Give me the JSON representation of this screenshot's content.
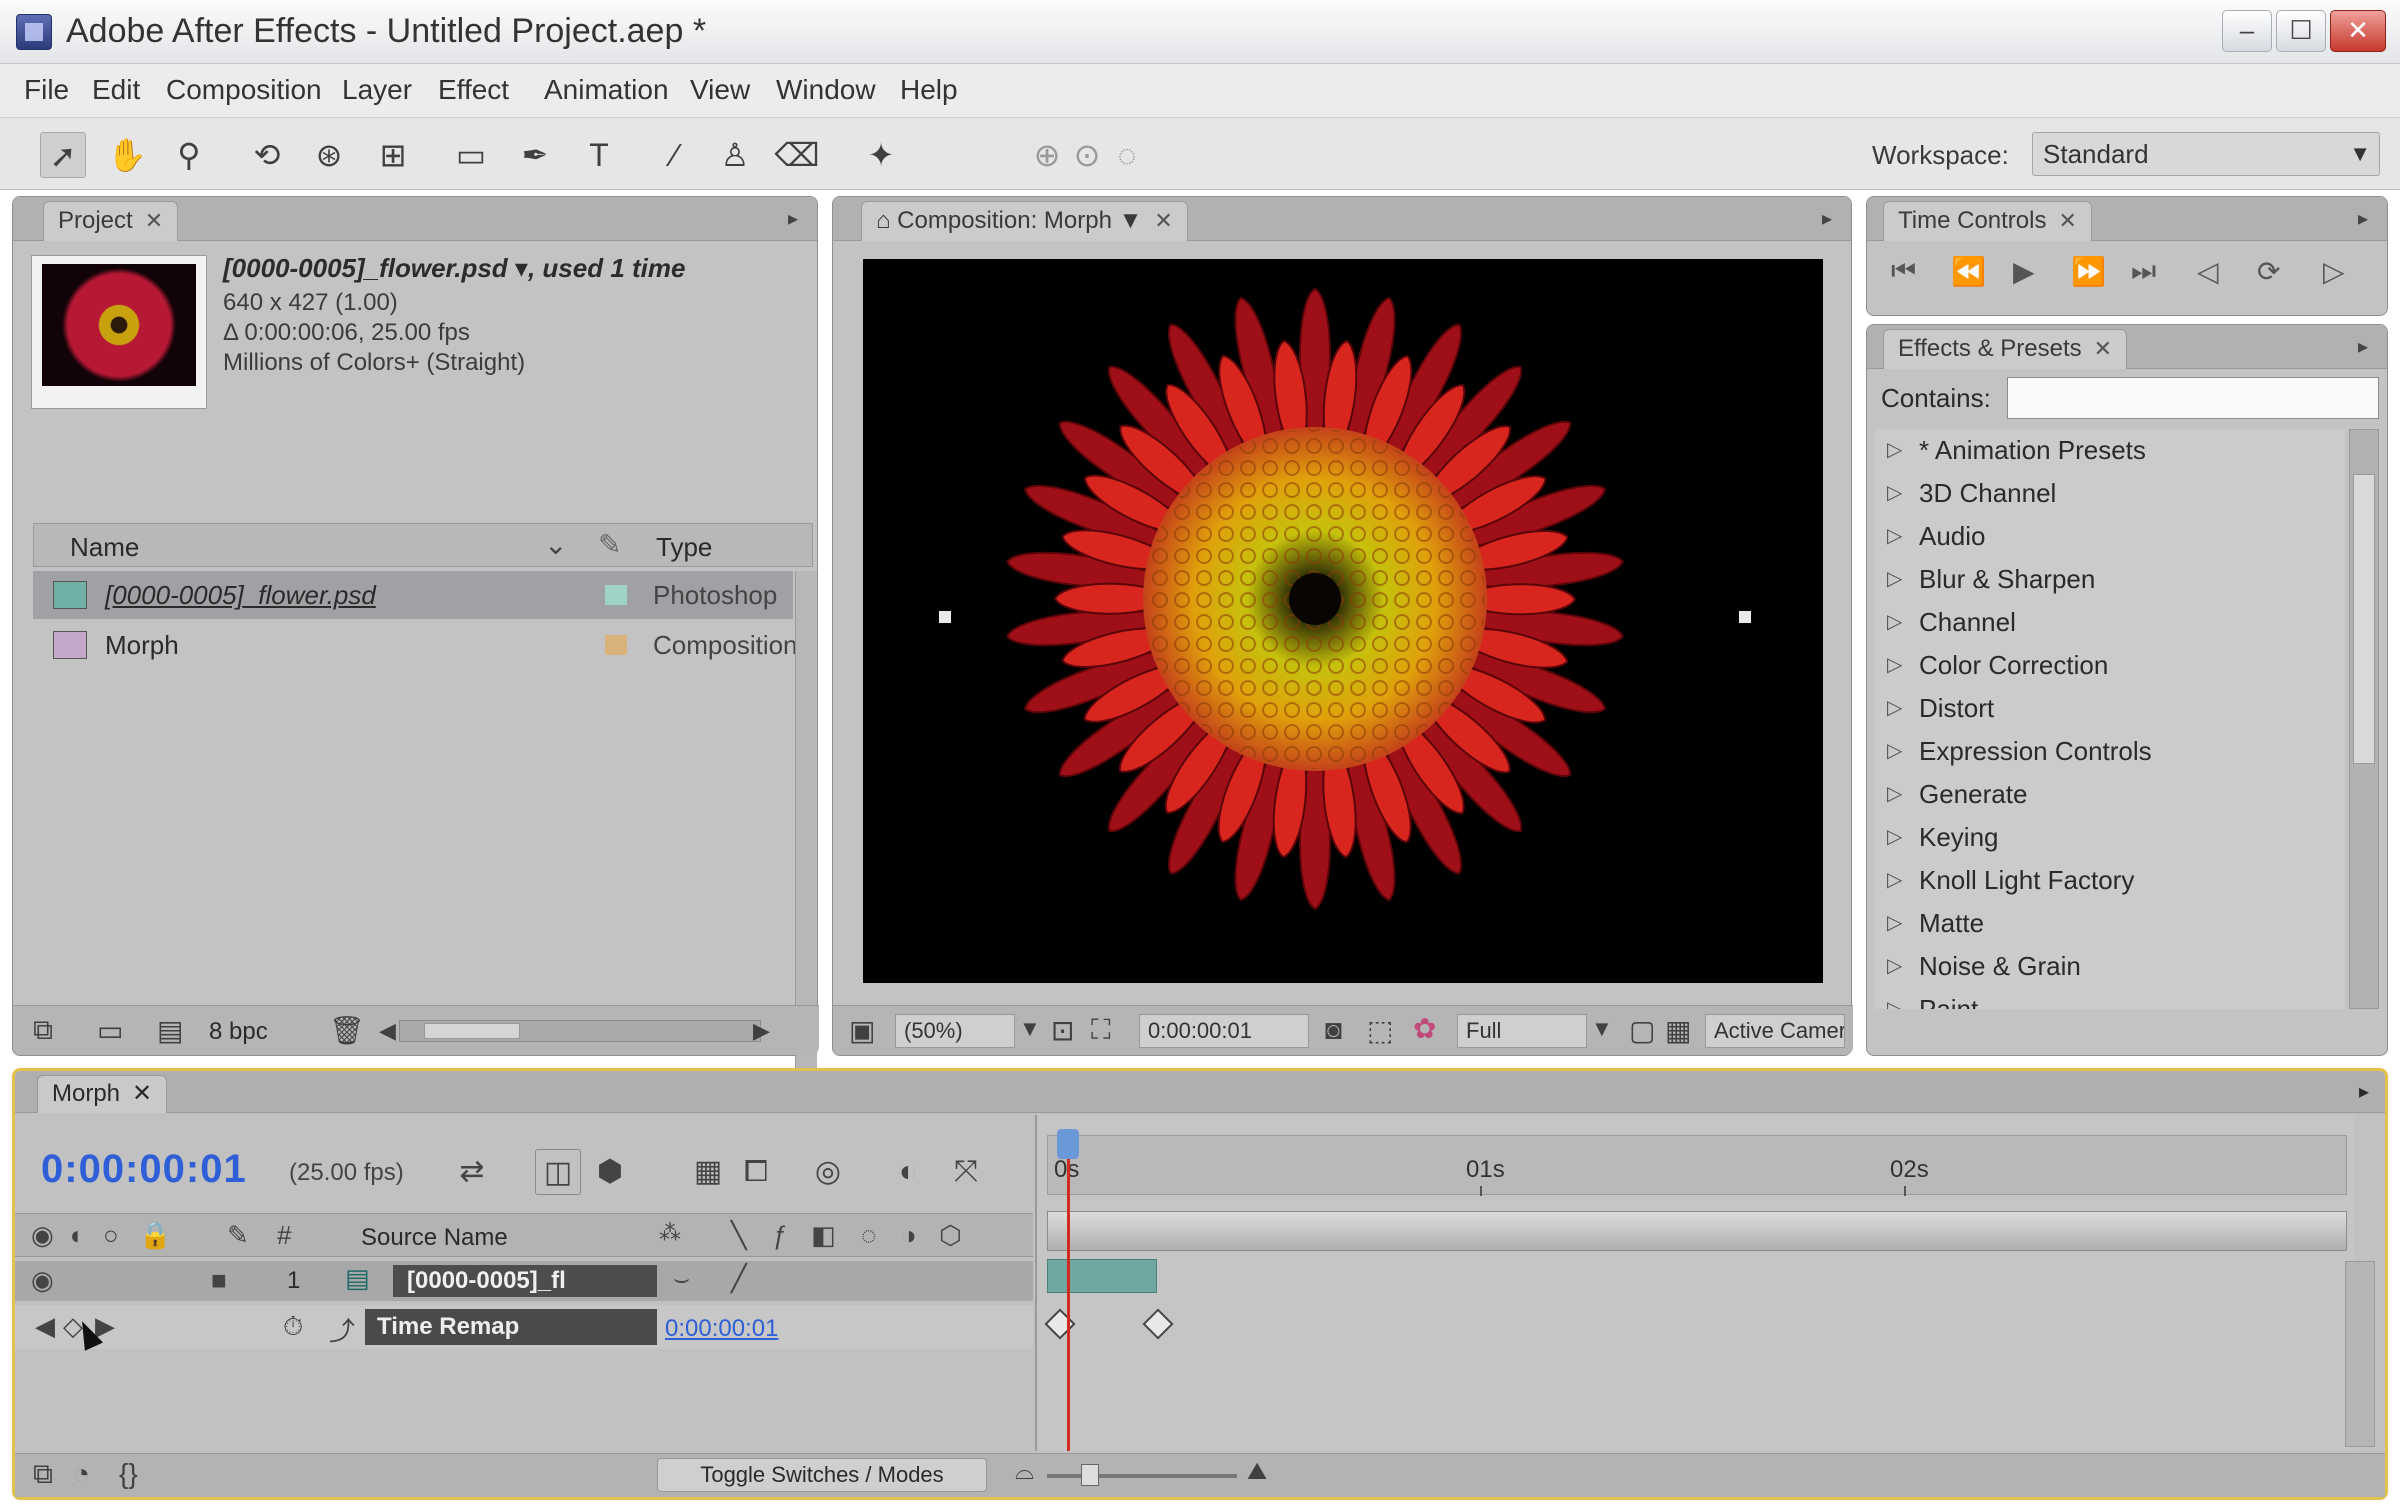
{
  "window": {
    "title": "Adobe After Effects - Untitled Project.aep *",
    "minimize": "–",
    "maximize": "☐",
    "close": "✕"
  },
  "menu": [
    "File",
    "Edit",
    "Composition",
    "Layer",
    "Effect",
    "Animation",
    "View",
    "Window",
    "Help"
  ],
  "toolbar": {
    "tools": [
      "selection-tool-icon",
      "hand-tool-icon",
      "zoom-tool-icon",
      "rotation-tool-icon",
      "orbit-camera-icon",
      "pan-behind-icon",
      "rectangle-tool-icon",
      "pen-tool-icon",
      "type-tool-icon",
      "brush-tool-icon",
      "clone-stamp-icon",
      "eraser-tool-icon",
      "puppet-pin-icon"
    ],
    "workspace_label": "Workspace:",
    "workspace_value": "Standard"
  },
  "project": {
    "tab": "Project",
    "footage_name": "[0000-0005]_flower.psd ▾, used 1 time",
    "meta": [
      "640 x 427 (1.00)",
      "Δ 0:00:00:06, 25.00 fps",
      "Millions of Colors+ (Straight)"
    ],
    "columns": {
      "name": "Name",
      "type": "Type"
    },
    "rows": [
      {
        "name": "[0000-0005]_flower.psd",
        "type": "Photoshop",
        "label_color": "#9fd3c8",
        "icon_color": "#6fb1a6"
      },
      {
        "name": "Morph",
        "type": "Composition",
        "label_color": "#d9b27a",
        "icon_color": "#c3a8c9"
      }
    ],
    "bpc": "8 bpc"
  },
  "composition": {
    "tab": "Composition: Morph",
    "zoom": "(50%)",
    "timecode": "0:00:00:01",
    "resolution": "Full",
    "view": "Active Camera"
  },
  "time_controls": {
    "tab": "Time Controls",
    "buttons": [
      "first-frame-icon",
      "prev-frame-icon",
      "play-icon",
      "next-frame-icon",
      "last-frame-icon",
      "audio-icon",
      "loop-icon",
      "ram-preview-icon"
    ]
  },
  "effects": {
    "tab": "Effects & Presets",
    "contains_label": "Contains:",
    "contains_value": "",
    "items": [
      "* Animation Presets",
      "3D Channel",
      "Audio",
      "Blur & Sharpen",
      "Channel",
      "Color Correction",
      "Distort",
      "Expression Controls",
      "Generate",
      "Keying",
      "Knoll Light Factory",
      "Matte",
      "Noise & Grain",
      "Paint"
    ]
  },
  "timeline": {
    "tab": "Morph",
    "timecode": "0:00:00:01",
    "fps": "(25.00 fps)",
    "source_name_header": "Source Name",
    "layer_number": "1",
    "layer_name": "[0000-0005]_fl",
    "property_name": "Time Remap",
    "property_value": "0:00:00:01",
    "ruler_labels": [
      "0s",
      "01s",
      "02s"
    ],
    "toggle_label": "Toggle Switches / Modes"
  },
  "colors": {
    "timecode_blue": "#2f5fd6",
    "timeline_highlight": "#e2c24b",
    "playhead": "#d12a1f"
  }
}
